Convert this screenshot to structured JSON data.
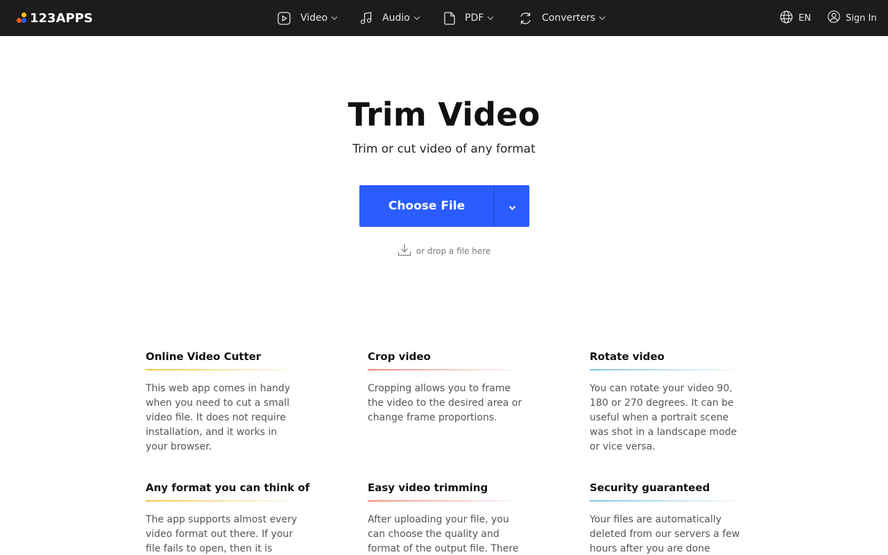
{
  "brand": {
    "name": "123APPS",
    "dot_colors": [
      "#ff5a1f",
      "#ffc107",
      "#2a5cff"
    ]
  },
  "nav": {
    "items": [
      {
        "label": "Video",
        "icon": "play-icon"
      },
      {
        "label": "Audio",
        "icon": "music-note-icon"
      },
      {
        "label": "PDF",
        "icon": "document-icon"
      },
      {
        "label": "Converters",
        "icon": "convert-icon"
      }
    ],
    "language": "EN",
    "sign_in": "Sign In"
  },
  "hero": {
    "title": "Trim Video",
    "subtitle": "Trim or cut video of any format",
    "choose_file": "Choose File",
    "drop_hint": "or drop a file here",
    "button_color": "#2a5cff"
  },
  "features": [
    {
      "title": "Online Video Cutter",
      "text": "This web app comes in handy when you need to cut a small video file. It does not require installation, and it works in your browser.",
      "accent": "#f5c542"
    },
    {
      "title": "Crop video",
      "text": "Cropping allows you to frame the video to the desired area or change frame proportions.",
      "accent": "#f08a7a"
    },
    {
      "title": "Rotate video",
      "text": "You can rotate your video 90, 180 or 270 degrees. It can be useful when a portrait scene was shot in a landscape mode or vice versa.",
      "accent": "#7cc4e6"
    },
    {
      "title": "Any format you can think of",
      "text": "The app supports almost every video format out there. If your file fails to open, then it is",
      "accent": "#f5c542"
    },
    {
      "title": "Easy video trimming",
      "text": "After uploading your file, you can choose the quality and format of the output file. There",
      "accent": "#f08a7a"
    },
    {
      "title": "Security guaranteed",
      "text": "Your files are automatically deleted from our servers a few hours after you are done",
      "accent": "#7cc4e6"
    }
  ]
}
